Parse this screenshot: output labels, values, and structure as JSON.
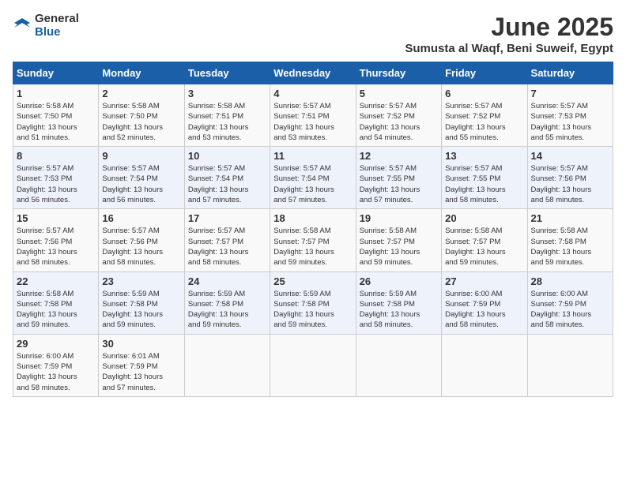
{
  "logo": {
    "general": "General",
    "blue": "Blue"
  },
  "title": "June 2025",
  "location": "Sumusta al Waqf, Beni Suweif, Egypt",
  "days_header": [
    "Sunday",
    "Monday",
    "Tuesday",
    "Wednesday",
    "Thursday",
    "Friday",
    "Saturday"
  ],
  "weeks": [
    [
      {
        "day": "1",
        "sunrise": "5:58 AM",
        "sunset": "7:50 PM",
        "daylight": "13 hours and 51 minutes."
      },
      {
        "day": "2",
        "sunrise": "5:58 AM",
        "sunset": "7:50 PM",
        "daylight": "13 hours and 52 minutes."
      },
      {
        "day": "3",
        "sunrise": "5:58 AM",
        "sunset": "7:51 PM",
        "daylight": "13 hours and 53 minutes."
      },
      {
        "day": "4",
        "sunrise": "5:57 AM",
        "sunset": "7:51 PM",
        "daylight": "13 hours and 53 minutes."
      },
      {
        "day": "5",
        "sunrise": "5:57 AM",
        "sunset": "7:52 PM",
        "daylight": "13 hours and 54 minutes."
      },
      {
        "day": "6",
        "sunrise": "5:57 AM",
        "sunset": "7:52 PM",
        "daylight": "13 hours and 55 minutes."
      },
      {
        "day": "7",
        "sunrise": "5:57 AM",
        "sunset": "7:53 PM",
        "daylight": "13 hours and 55 minutes."
      }
    ],
    [
      {
        "day": "8",
        "sunrise": "5:57 AM",
        "sunset": "7:53 PM",
        "daylight": "13 hours and 56 minutes."
      },
      {
        "day": "9",
        "sunrise": "5:57 AM",
        "sunset": "7:54 PM",
        "daylight": "13 hours and 56 minutes."
      },
      {
        "day": "10",
        "sunrise": "5:57 AM",
        "sunset": "7:54 PM",
        "daylight": "13 hours and 57 minutes."
      },
      {
        "day": "11",
        "sunrise": "5:57 AM",
        "sunset": "7:54 PM",
        "daylight": "13 hours and 57 minutes."
      },
      {
        "day": "12",
        "sunrise": "5:57 AM",
        "sunset": "7:55 PM",
        "daylight": "13 hours and 57 minutes."
      },
      {
        "day": "13",
        "sunrise": "5:57 AM",
        "sunset": "7:55 PM",
        "daylight": "13 hours and 58 minutes."
      },
      {
        "day": "14",
        "sunrise": "5:57 AM",
        "sunset": "7:56 PM",
        "daylight": "13 hours and 58 minutes."
      }
    ],
    [
      {
        "day": "15",
        "sunrise": "5:57 AM",
        "sunset": "7:56 PM",
        "daylight": "13 hours and 58 minutes."
      },
      {
        "day": "16",
        "sunrise": "5:57 AM",
        "sunset": "7:56 PM",
        "daylight": "13 hours and 58 minutes."
      },
      {
        "day": "17",
        "sunrise": "5:57 AM",
        "sunset": "7:57 PM",
        "daylight": "13 hours and 58 minutes."
      },
      {
        "day": "18",
        "sunrise": "5:58 AM",
        "sunset": "7:57 PM",
        "daylight": "13 hours and 59 minutes."
      },
      {
        "day": "19",
        "sunrise": "5:58 AM",
        "sunset": "7:57 PM",
        "daylight": "13 hours and 59 minutes."
      },
      {
        "day": "20",
        "sunrise": "5:58 AM",
        "sunset": "7:57 PM",
        "daylight": "13 hours and 59 minutes."
      },
      {
        "day": "21",
        "sunrise": "5:58 AM",
        "sunset": "7:58 PM",
        "daylight": "13 hours and 59 minutes."
      }
    ],
    [
      {
        "day": "22",
        "sunrise": "5:58 AM",
        "sunset": "7:58 PM",
        "daylight": "13 hours and 59 minutes."
      },
      {
        "day": "23",
        "sunrise": "5:59 AM",
        "sunset": "7:58 PM",
        "daylight": "13 hours and 59 minutes."
      },
      {
        "day": "24",
        "sunrise": "5:59 AM",
        "sunset": "7:58 PM",
        "daylight": "13 hours and 59 minutes."
      },
      {
        "day": "25",
        "sunrise": "5:59 AM",
        "sunset": "7:58 PM",
        "daylight": "13 hours and 59 minutes."
      },
      {
        "day": "26",
        "sunrise": "5:59 AM",
        "sunset": "7:58 PM",
        "daylight": "13 hours and 58 minutes."
      },
      {
        "day": "27",
        "sunrise": "6:00 AM",
        "sunset": "7:59 PM",
        "daylight": "13 hours and 58 minutes."
      },
      {
        "day": "28",
        "sunrise": "6:00 AM",
        "sunset": "7:59 PM",
        "daylight": "13 hours and 58 minutes."
      }
    ],
    [
      {
        "day": "29",
        "sunrise": "6:00 AM",
        "sunset": "7:59 PM",
        "daylight": "13 hours and 58 minutes."
      },
      {
        "day": "30",
        "sunrise": "6:01 AM",
        "sunset": "7:59 PM",
        "daylight": "13 hours and 57 minutes."
      },
      null,
      null,
      null,
      null,
      null
    ]
  ]
}
